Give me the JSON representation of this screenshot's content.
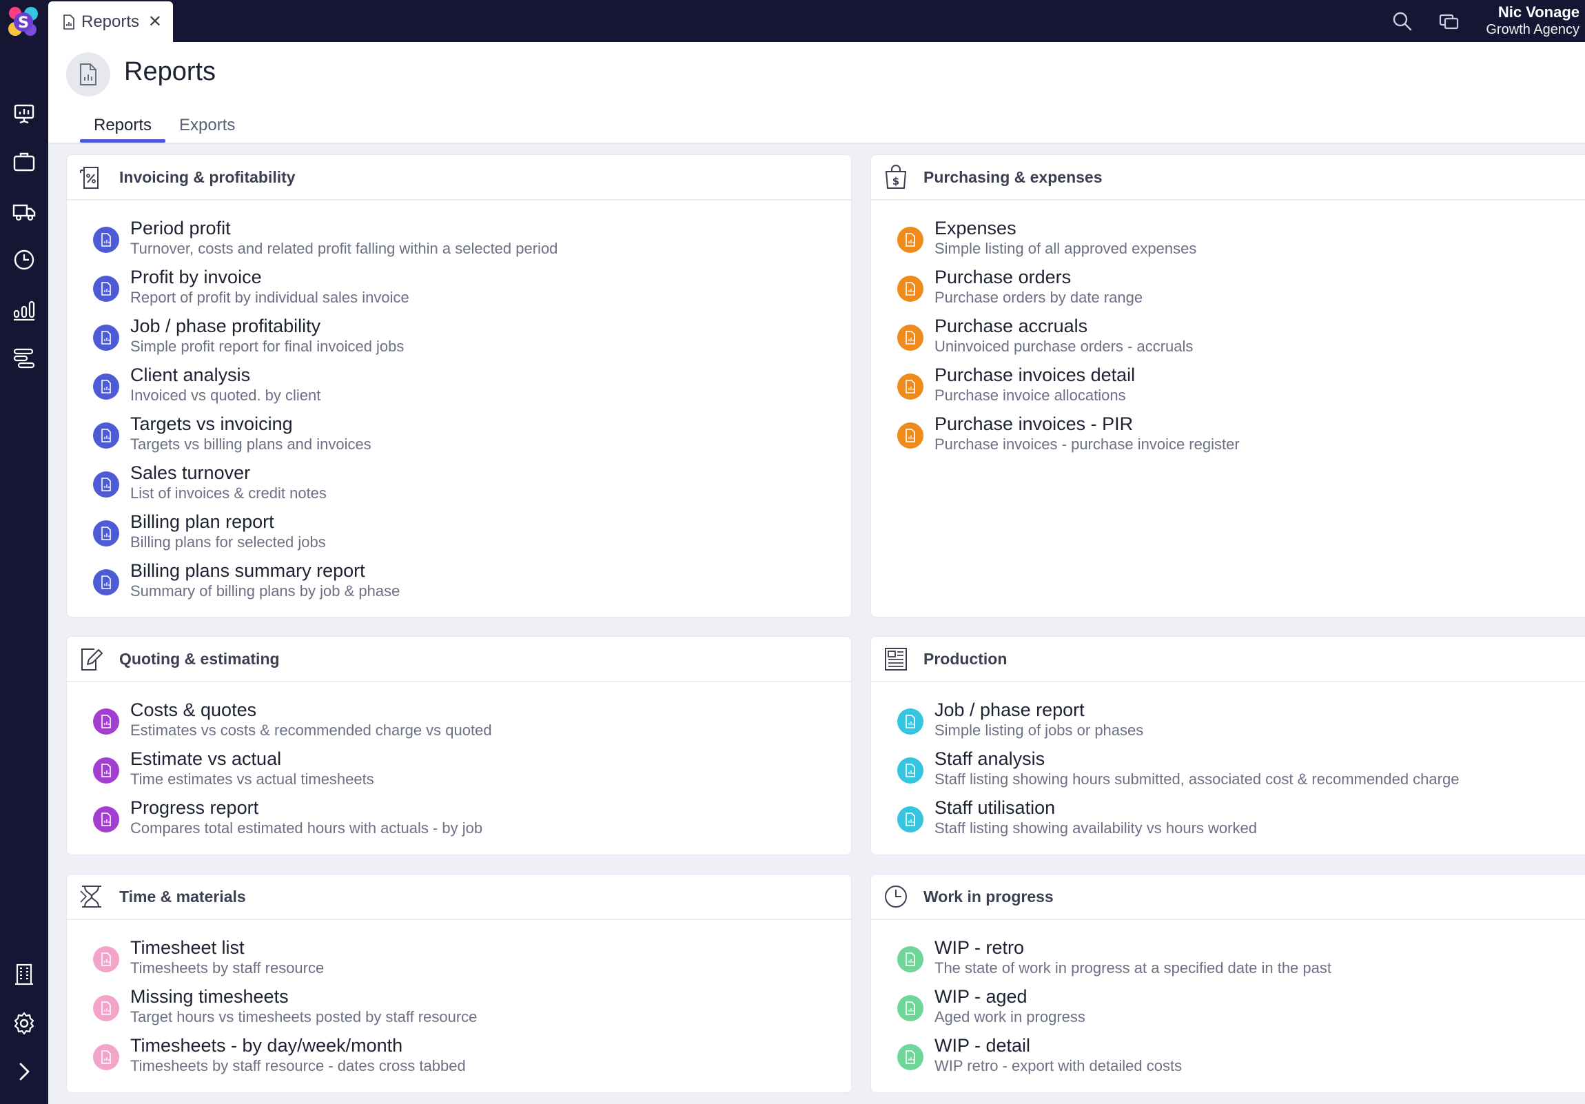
{
  "app": {
    "open_tab": "Reports",
    "user_name": "Nic Vonage",
    "user_org": "Growth Agency"
  },
  "page": {
    "title": "Reports",
    "tabs": [
      {
        "label": "Reports",
        "active": true
      },
      {
        "label": "Exports",
        "active": false
      }
    ]
  },
  "colors": {
    "blue": "#4d5bd6",
    "orange": "#ef8b1a",
    "purple": "#a23fd0",
    "cyan": "#35c5e0",
    "pink": "#f2a4c9",
    "green": "#6fd69a",
    "accent": "#4e5ad8",
    "nav_bg": "#141633"
  },
  "sections": {
    "invoicing": {
      "title": "Invoicing & profitability",
      "icon": "invoice-percent-icon",
      "items": [
        {
          "title": "Period profit",
          "desc": "Turnover, costs and related profit falling within a selected period"
        },
        {
          "title": "Profit by invoice",
          "desc": "Report of profit by individual sales invoice"
        },
        {
          "title": "Job / phase profitability",
          "desc": "Simple profit report for final invoiced jobs"
        },
        {
          "title": "Client analysis",
          "desc": "Invoiced vs quoted. by client"
        },
        {
          "title": "Targets vs invoicing",
          "desc": "Targets vs billing plans and invoices"
        },
        {
          "title": "Sales turnover",
          "desc": "List of invoices & credit notes"
        },
        {
          "title": "Billing plan report",
          "desc": "Billing plans for selected jobs"
        },
        {
          "title": "Billing plans summary report",
          "desc": "Summary of billing plans by job & phase"
        }
      ]
    },
    "purchasing": {
      "title": "Purchasing & expenses",
      "icon": "shopping-bag-dollar-icon",
      "items": [
        {
          "title": "Expenses",
          "desc": "Simple listing of all approved expenses"
        },
        {
          "title": "Purchase orders",
          "desc": "Purchase orders by date range"
        },
        {
          "title": "Purchase accruals",
          "desc": "Uninvoiced purchase orders - accruals"
        },
        {
          "title": "Purchase invoices detail",
          "desc": "Purchase invoice allocations"
        },
        {
          "title": "Purchase invoices - PIR",
          "desc": "Purchase invoices - purchase invoice register"
        }
      ]
    },
    "quoting": {
      "title": "Quoting & estimating",
      "icon": "edit-document-icon",
      "items": [
        {
          "title": "Costs & quotes",
          "desc": "Estimates vs costs & recommended charge vs quoted"
        },
        {
          "title": "Estimate vs actual",
          "desc": "Time estimates vs actual timesheets"
        },
        {
          "title": "Progress report",
          "desc": "Compares total estimated hours with actuals - by job"
        }
      ]
    },
    "production": {
      "title": "Production",
      "icon": "newspaper-icon",
      "items": [
        {
          "title": "Job / phase report",
          "desc": "Simple listing of jobs or phases"
        },
        {
          "title": "Staff analysis",
          "desc": "Staff listing showing hours submitted, associated cost & recommended charge"
        },
        {
          "title": "Staff utilisation",
          "desc": "Staff listing showing availability vs hours worked"
        }
      ]
    },
    "time": {
      "title": "Time & materials",
      "icon": "hourglass-icon",
      "items": [
        {
          "title": "Timesheet list",
          "desc": "Timesheets by staff resource"
        },
        {
          "title": "Missing timesheets",
          "desc": "Target hours vs timesheets posted by staff resource"
        },
        {
          "title": "Timesheets - by day/week/month",
          "desc": "Timesheets by staff resource - dates cross tabbed"
        }
      ]
    },
    "wip": {
      "title": "Work in progress",
      "icon": "clock-icon",
      "items": [
        {
          "title": "WIP - retro",
          "desc": "The state of work in progress at a specified date in the past"
        },
        {
          "title": "WIP - aged",
          "desc": "Aged work in progress"
        },
        {
          "title": "WIP - detail",
          "desc": "WIP retro - export with detailed costs"
        }
      ]
    }
  }
}
